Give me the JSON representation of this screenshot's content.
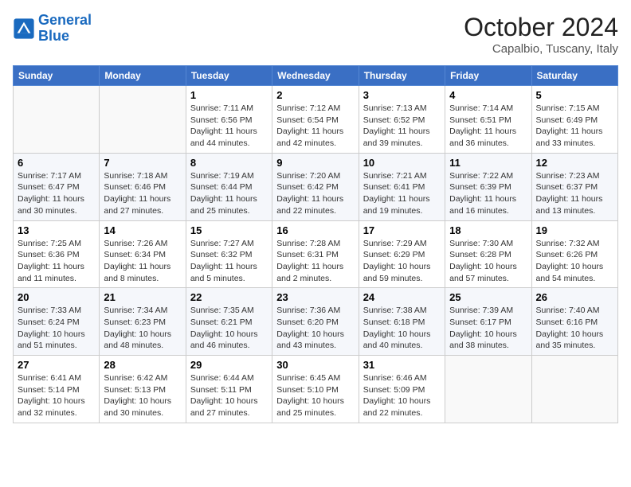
{
  "header": {
    "logo": {
      "line1": "General",
      "line2": "Blue"
    },
    "month": "October 2024",
    "location": "Capalbio, Tuscany, Italy"
  },
  "weekdays": [
    "Sunday",
    "Monday",
    "Tuesday",
    "Wednesday",
    "Thursday",
    "Friday",
    "Saturday"
  ],
  "weeks": [
    [
      {
        "day": "",
        "info": ""
      },
      {
        "day": "",
        "info": ""
      },
      {
        "day": "1",
        "info": "Sunrise: 7:11 AM\nSunset: 6:56 PM\nDaylight: 11 hours and 44 minutes."
      },
      {
        "day": "2",
        "info": "Sunrise: 7:12 AM\nSunset: 6:54 PM\nDaylight: 11 hours and 42 minutes."
      },
      {
        "day": "3",
        "info": "Sunrise: 7:13 AM\nSunset: 6:52 PM\nDaylight: 11 hours and 39 minutes."
      },
      {
        "day": "4",
        "info": "Sunrise: 7:14 AM\nSunset: 6:51 PM\nDaylight: 11 hours and 36 minutes."
      },
      {
        "day": "5",
        "info": "Sunrise: 7:15 AM\nSunset: 6:49 PM\nDaylight: 11 hours and 33 minutes."
      }
    ],
    [
      {
        "day": "6",
        "info": "Sunrise: 7:17 AM\nSunset: 6:47 PM\nDaylight: 11 hours and 30 minutes."
      },
      {
        "day": "7",
        "info": "Sunrise: 7:18 AM\nSunset: 6:46 PM\nDaylight: 11 hours and 27 minutes."
      },
      {
        "day": "8",
        "info": "Sunrise: 7:19 AM\nSunset: 6:44 PM\nDaylight: 11 hours and 25 minutes."
      },
      {
        "day": "9",
        "info": "Sunrise: 7:20 AM\nSunset: 6:42 PM\nDaylight: 11 hours and 22 minutes."
      },
      {
        "day": "10",
        "info": "Sunrise: 7:21 AM\nSunset: 6:41 PM\nDaylight: 11 hours and 19 minutes."
      },
      {
        "day": "11",
        "info": "Sunrise: 7:22 AM\nSunset: 6:39 PM\nDaylight: 11 hours and 16 minutes."
      },
      {
        "day": "12",
        "info": "Sunrise: 7:23 AM\nSunset: 6:37 PM\nDaylight: 11 hours and 13 minutes."
      }
    ],
    [
      {
        "day": "13",
        "info": "Sunrise: 7:25 AM\nSunset: 6:36 PM\nDaylight: 11 hours and 11 minutes."
      },
      {
        "day": "14",
        "info": "Sunrise: 7:26 AM\nSunset: 6:34 PM\nDaylight: 11 hours and 8 minutes."
      },
      {
        "day": "15",
        "info": "Sunrise: 7:27 AM\nSunset: 6:32 PM\nDaylight: 11 hours and 5 minutes."
      },
      {
        "day": "16",
        "info": "Sunrise: 7:28 AM\nSunset: 6:31 PM\nDaylight: 11 hours and 2 minutes."
      },
      {
        "day": "17",
        "info": "Sunrise: 7:29 AM\nSunset: 6:29 PM\nDaylight: 10 hours and 59 minutes."
      },
      {
        "day": "18",
        "info": "Sunrise: 7:30 AM\nSunset: 6:28 PM\nDaylight: 10 hours and 57 minutes."
      },
      {
        "day": "19",
        "info": "Sunrise: 7:32 AM\nSunset: 6:26 PM\nDaylight: 10 hours and 54 minutes."
      }
    ],
    [
      {
        "day": "20",
        "info": "Sunrise: 7:33 AM\nSunset: 6:24 PM\nDaylight: 10 hours and 51 minutes."
      },
      {
        "day": "21",
        "info": "Sunrise: 7:34 AM\nSunset: 6:23 PM\nDaylight: 10 hours and 48 minutes."
      },
      {
        "day": "22",
        "info": "Sunrise: 7:35 AM\nSunset: 6:21 PM\nDaylight: 10 hours and 46 minutes."
      },
      {
        "day": "23",
        "info": "Sunrise: 7:36 AM\nSunset: 6:20 PM\nDaylight: 10 hours and 43 minutes."
      },
      {
        "day": "24",
        "info": "Sunrise: 7:38 AM\nSunset: 6:18 PM\nDaylight: 10 hours and 40 minutes."
      },
      {
        "day": "25",
        "info": "Sunrise: 7:39 AM\nSunset: 6:17 PM\nDaylight: 10 hours and 38 minutes."
      },
      {
        "day": "26",
        "info": "Sunrise: 7:40 AM\nSunset: 6:16 PM\nDaylight: 10 hours and 35 minutes."
      }
    ],
    [
      {
        "day": "27",
        "info": "Sunrise: 6:41 AM\nSunset: 5:14 PM\nDaylight: 10 hours and 32 minutes."
      },
      {
        "day": "28",
        "info": "Sunrise: 6:42 AM\nSunset: 5:13 PM\nDaylight: 10 hours and 30 minutes."
      },
      {
        "day": "29",
        "info": "Sunrise: 6:44 AM\nSunset: 5:11 PM\nDaylight: 10 hours and 27 minutes."
      },
      {
        "day": "30",
        "info": "Sunrise: 6:45 AM\nSunset: 5:10 PM\nDaylight: 10 hours and 25 minutes."
      },
      {
        "day": "31",
        "info": "Sunrise: 6:46 AM\nSunset: 5:09 PM\nDaylight: 10 hours and 22 minutes."
      },
      {
        "day": "",
        "info": ""
      },
      {
        "day": "",
        "info": ""
      }
    ]
  ]
}
